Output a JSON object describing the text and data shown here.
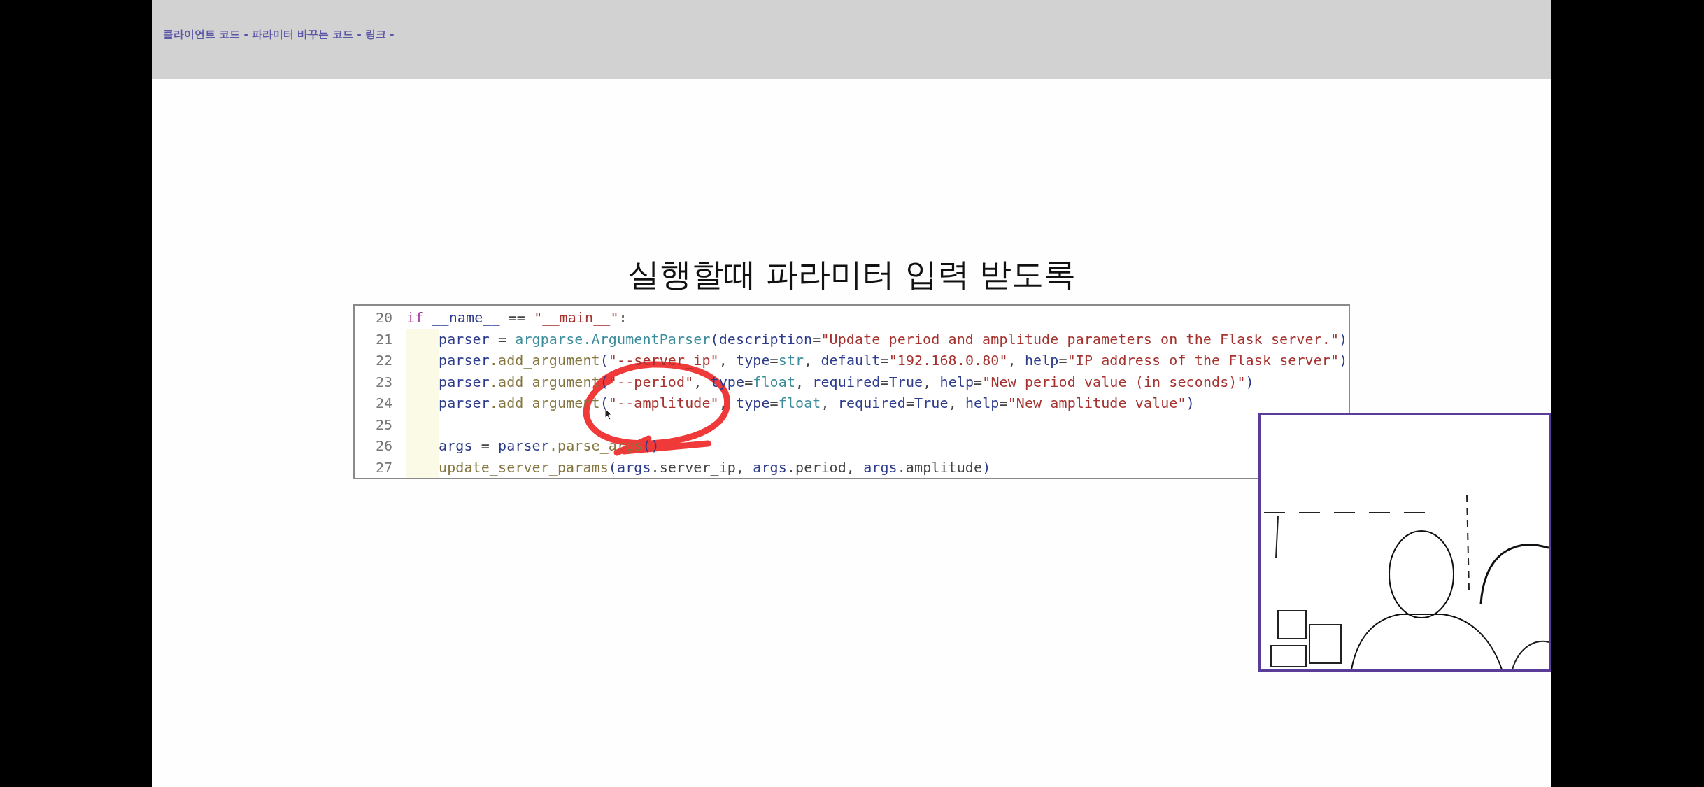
{
  "header": {
    "title": "클라이언트 코드 - 파라미터 바꾸는 코드 - 링크 -"
  },
  "slide": {
    "title": "실행할때 파라미터 입력 받도록",
    "code_lines": [
      {
        "number": "20",
        "indent": false,
        "tokens": [
          {
            "t": "if ",
            "kind": "keyword"
          },
          {
            "t": "__name__",
            "kind": "name"
          },
          {
            "t": " == ",
            "kind": "plain"
          },
          {
            "t": "\"__main__\"",
            "kind": "string"
          },
          {
            "t": ":",
            "kind": "plain"
          }
        ]
      },
      {
        "number": "21",
        "indent": true,
        "tokens": [
          {
            "t": "parser",
            "kind": "name"
          },
          {
            "t": " = ",
            "kind": "plain"
          },
          {
            "t": "argparse.ArgumentParser",
            "kind": "builtin"
          },
          {
            "t": "(",
            "kind": "name"
          },
          {
            "t": "description",
            "kind": "name"
          },
          {
            "t": "=",
            "kind": "plain"
          },
          {
            "t": "\"Update period and amplitude parameters on the Flask server.\"",
            "kind": "string"
          },
          {
            "t": ")",
            "kind": "name"
          }
        ]
      },
      {
        "number": "22",
        "indent": true,
        "tokens": [
          {
            "t": "parser",
            "kind": "name"
          },
          {
            "t": ".add_argument",
            "kind": "func"
          },
          {
            "t": "(",
            "kind": "name"
          },
          {
            "t": "\"--server_ip\"",
            "kind": "string"
          },
          {
            "t": ", ",
            "kind": "plain"
          },
          {
            "t": "type",
            "kind": "name"
          },
          {
            "t": "=",
            "kind": "plain"
          },
          {
            "t": "str",
            "kind": "builtin"
          },
          {
            "t": ", ",
            "kind": "plain"
          },
          {
            "t": "default",
            "kind": "name"
          },
          {
            "t": "=",
            "kind": "plain"
          },
          {
            "t": "\"192.168.0.80\"",
            "kind": "string"
          },
          {
            "t": ", ",
            "kind": "plain"
          },
          {
            "t": "help",
            "kind": "name"
          },
          {
            "t": "=",
            "kind": "plain"
          },
          {
            "t": "\"IP address of the Flask server\"",
            "kind": "string"
          },
          {
            "t": ")",
            "kind": "name"
          }
        ]
      },
      {
        "number": "23",
        "indent": true,
        "tokens": [
          {
            "t": "parser",
            "kind": "name"
          },
          {
            "t": ".add_argument",
            "kind": "func"
          },
          {
            "t": "(",
            "kind": "name"
          },
          {
            "t": "\"--period\"",
            "kind": "string"
          },
          {
            "t": ", ",
            "kind": "plain"
          },
          {
            "t": "type",
            "kind": "name"
          },
          {
            "t": "=",
            "kind": "plain"
          },
          {
            "t": "float",
            "kind": "builtin"
          },
          {
            "t": ", ",
            "kind": "plain"
          },
          {
            "t": "required",
            "kind": "name"
          },
          {
            "t": "=",
            "kind": "plain"
          },
          {
            "t": "True",
            "kind": "const"
          },
          {
            "t": ", ",
            "kind": "plain"
          },
          {
            "t": "help",
            "kind": "name"
          },
          {
            "t": "=",
            "kind": "plain"
          },
          {
            "t": "\"New period value (in seconds)\"",
            "kind": "string"
          },
          {
            "t": ")",
            "kind": "name"
          }
        ]
      },
      {
        "number": "24",
        "indent": true,
        "tokens": [
          {
            "t": "parser",
            "kind": "name"
          },
          {
            "t": ".add_argument",
            "kind": "func"
          },
          {
            "t": "(",
            "kind": "name"
          },
          {
            "t": "\"--amplitude\"",
            "kind": "string"
          },
          {
            "t": ", ",
            "kind": "plain"
          },
          {
            "t": "type",
            "kind": "name"
          },
          {
            "t": "=",
            "kind": "plain"
          },
          {
            "t": "float",
            "kind": "builtin"
          },
          {
            "t": ", ",
            "kind": "plain"
          },
          {
            "t": "required",
            "kind": "name"
          },
          {
            "t": "=",
            "kind": "plain"
          },
          {
            "t": "True",
            "kind": "const"
          },
          {
            "t": ", ",
            "kind": "plain"
          },
          {
            "t": "help",
            "kind": "name"
          },
          {
            "t": "=",
            "kind": "plain"
          },
          {
            "t": "\"New amplitude value\"",
            "kind": "string"
          },
          {
            "t": ")",
            "kind": "name"
          }
        ]
      },
      {
        "number": "25",
        "indent": true
      },
      {
        "number": "26",
        "indent": true,
        "tokens": [
          {
            "t": "args",
            "kind": "name"
          },
          {
            "t": " = ",
            "kind": "plain"
          },
          {
            "t": "parser",
            "kind": "name"
          },
          {
            "t": ".parse_args",
            "kind": "func"
          },
          {
            "t": "()",
            "kind": "name"
          }
        ]
      },
      {
        "number": "27",
        "indent": true,
        "tokens": [
          {
            "t": "update_server_params",
            "kind": "func"
          },
          {
            "t": "(",
            "kind": "name"
          },
          {
            "t": "args",
            "kind": "name"
          },
          {
            "t": ".server_ip, ",
            "kind": "plain"
          },
          {
            "t": "args",
            "kind": "name"
          },
          {
            "t": ".period, ",
            "kind": "plain"
          },
          {
            "t": "args",
            "kind": "name"
          },
          {
            "t": ".amplitude",
            "kind": "plain"
          },
          {
            "t": ")",
            "kind": "name"
          }
        ]
      }
    ]
  }
}
